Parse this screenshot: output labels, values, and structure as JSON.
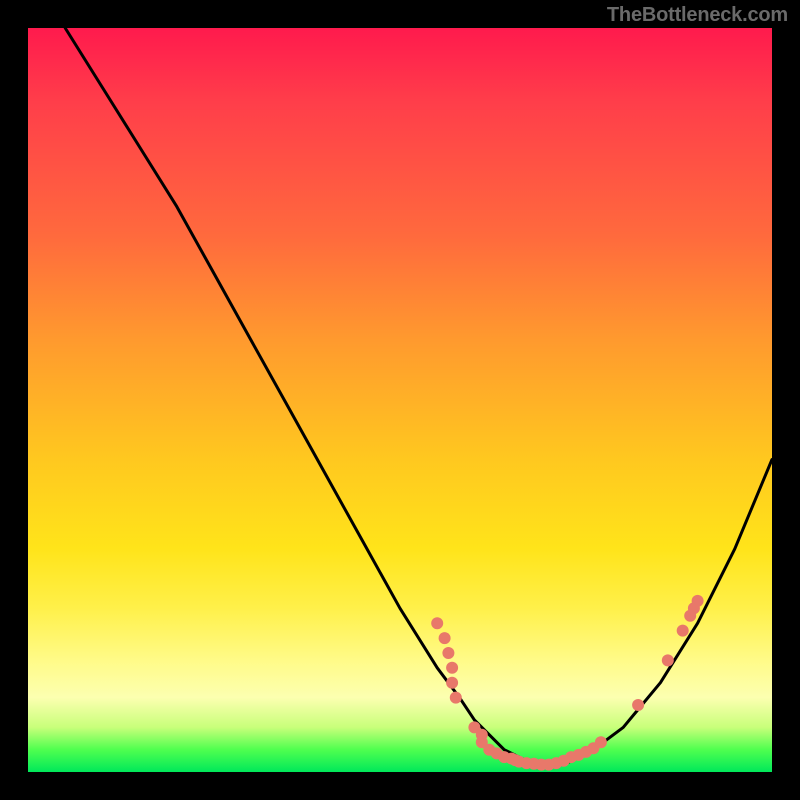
{
  "watermark": "TheBottleneck.com",
  "colors": {
    "background": "#000000",
    "curve": "#000000",
    "marker": "#e8786a",
    "gradient_top": "#ff1a4d",
    "gradient_bottom": "#00e85a"
  },
  "chart_data": {
    "type": "line",
    "title": "",
    "xlabel": "",
    "ylabel": "",
    "xlim": [
      0,
      100
    ],
    "ylim": [
      0,
      100
    ],
    "series": [
      {
        "name": "bottleneck-curve",
        "x": [
          5,
          10,
          15,
          20,
          25,
          30,
          35,
          40,
          45,
          50,
          55,
          58,
          60,
          62,
          64,
          66,
          68,
          70,
          72,
          74,
          76,
          80,
          85,
          90,
          95,
          100
        ],
        "y": [
          100,
          92,
          84,
          76,
          67,
          58,
          49,
          40,
          31,
          22,
          14,
          10,
          7,
          5,
          3,
          2,
          1,
          1,
          1,
          2,
          3,
          6,
          12,
          20,
          30,
          42
        ]
      }
    ],
    "markers": [
      {
        "x": 55,
        "y": 20
      },
      {
        "x": 56,
        "y": 18
      },
      {
        "x": 56.5,
        "y": 16
      },
      {
        "x": 57,
        "y": 14
      },
      {
        "x": 57,
        "y": 12
      },
      {
        "x": 57.5,
        "y": 10
      },
      {
        "x": 60,
        "y": 6
      },
      {
        "x": 61,
        "y": 5
      },
      {
        "x": 61,
        "y": 4
      },
      {
        "x": 62,
        "y": 3
      },
      {
        "x": 63,
        "y": 2.5
      },
      {
        "x": 64,
        "y": 2
      },
      {
        "x": 65,
        "y": 1.8
      },
      {
        "x": 65.5,
        "y": 1.6
      },
      {
        "x": 66,
        "y": 1.4
      },
      {
        "x": 67,
        "y": 1.2
      },
      {
        "x": 68,
        "y": 1.1
      },
      {
        "x": 69,
        "y": 1
      },
      {
        "x": 70,
        "y": 1
      },
      {
        "x": 71,
        "y": 1.2
      },
      {
        "x": 72,
        "y": 1.5
      },
      {
        "x": 73,
        "y": 2
      },
      {
        "x": 74,
        "y": 2.3
      },
      {
        "x": 75,
        "y": 2.7
      },
      {
        "x": 76,
        "y": 3.2
      },
      {
        "x": 77,
        "y": 4
      },
      {
        "x": 82,
        "y": 9
      },
      {
        "x": 86,
        "y": 15
      },
      {
        "x": 88,
        "y": 19
      },
      {
        "x": 89,
        "y": 21
      },
      {
        "x": 89.5,
        "y": 22
      },
      {
        "x": 90,
        "y": 23
      }
    ]
  }
}
